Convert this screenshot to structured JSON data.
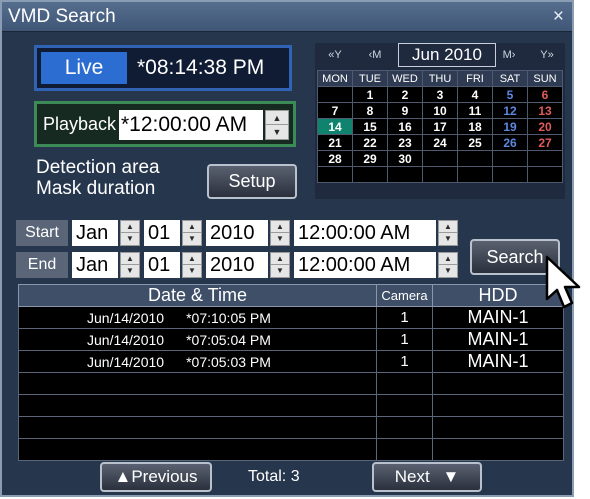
{
  "window": {
    "title": "VMD Search",
    "close": "×"
  },
  "live": {
    "label": "Live",
    "time": "*08:14:38 PM"
  },
  "playback": {
    "label": "Playback",
    "time": "*12:00:00 AM"
  },
  "detection": {
    "line1": "Detection area",
    "line2": "Mask duration",
    "setup_label": "Setup"
  },
  "calendar": {
    "prev_year": "«Y",
    "prev_month": "‹M",
    "month_year": "Jun 2010",
    "next_month": "M›",
    "next_year": "Y»",
    "weekdays": [
      "MON",
      "TUE",
      "WED",
      "THU",
      "FRI",
      "SAT",
      "SUN"
    ],
    "weeks": [
      [
        "",
        "1",
        "2",
        "3",
        "4",
        "5",
        "6"
      ],
      [
        "7",
        "8",
        "9",
        "10",
        "11",
        "12",
        "13"
      ],
      [
        "14",
        "15",
        "16",
        "17",
        "18",
        "19",
        "20"
      ],
      [
        "21",
        "22",
        "23",
        "24",
        "25",
        "26",
        "27"
      ],
      [
        "28",
        "29",
        "30",
        "",
        "",
        "",
        ""
      ],
      [
        "",
        "",
        "",
        "",
        "",
        "",
        ""
      ]
    ],
    "selected_day": "14"
  },
  "start": {
    "label": "Start",
    "month": "Jan",
    "day": "01",
    "year": "2010",
    "time": "12:00:00 AM"
  },
  "end": {
    "label": "End",
    "month": "Jan",
    "day": "01",
    "year": "2010",
    "time": "12:00:00 AM"
  },
  "search_label": "Search",
  "results": {
    "headers": {
      "datetime": "Date & Time",
      "camera": "Camera",
      "hdd": "HDD"
    },
    "rows": [
      {
        "date": "Jun/14/2010",
        "time": "*07:10:05 PM",
        "camera": "1",
        "hdd": "MAIN-1"
      },
      {
        "date": "Jun/14/2010",
        "time": "*07:05:04 PM",
        "camera": "1",
        "hdd": "MAIN-1"
      },
      {
        "date": "Jun/14/2010",
        "time": "*07:05:03 PM",
        "camera": "1",
        "hdd": "MAIN-1"
      }
    ]
  },
  "footer": {
    "previous_label": "Previous",
    "total_label": "Total:",
    "total_value": "3",
    "next_label": "Next"
  },
  "colors": {
    "window_bg": "#26364d",
    "live_accent": "#2c6dd2",
    "playback_border": "#3c8a55",
    "selected_day": "#10836f"
  }
}
